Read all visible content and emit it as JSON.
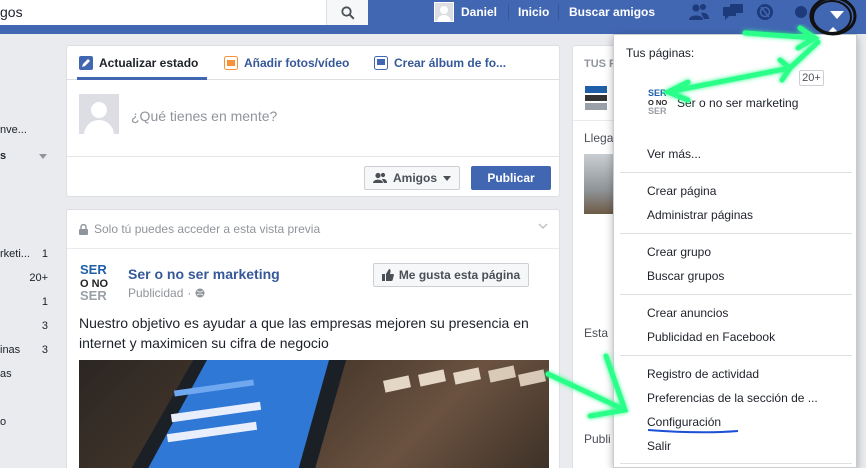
{
  "topbar": {
    "search_value": "gos",
    "user_name": "Daniel",
    "nav_home": "Inicio",
    "nav_find_friends": "Buscar amigos"
  },
  "left_sidebar": {
    "items": [
      {
        "label": "nve..."
      },
      {
        "label": "s"
      },
      {
        "label": "rketi...",
        "count": "1"
      },
      {
        "label": "",
        "count": "20+"
      },
      {
        "label": "",
        "count": "1"
      },
      {
        "label": "",
        "count": "3"
      },
      {
        "label": "inas",
        "count": "3"
      },
      {
        "label": "as"
      },
      {
        "label": "o"
      }
    ]
  },
  "composer": {
    "tab_status": "Actualizar estado",
    "tab_photos": "Añadir fotos/vídeo",
    "tab_album": "Crear álbum de fo...",
    "placeholder": "¿Qué tienes en mente?",
    "audience": "Amigos",
    "publish": "Publicar"
  },
  "post": {
    "preview_notice": "Solo tú puedes acceder a esta vista previa",
    "page_name": "Ser o no ser marketing",
    "meta": "Publicidad",
    "like_button": "Me gusta esta página",
    "text": "Nuestro objetivo es ayudar a que las empresas mejoren su presencia en internet y maximicen su cifra de negocio",
    "logo_lines": [
      "SER",
      "O NO",
      "SER"
    ]
  },
  "right_column": {
    "heading": "TUS P",
    "label_llega": "Llega",
    "label_esta": "Esta",
    "label_publi": "Publi"
  },
  "dropdown": {
    "heading": "Tus páginas:",
    "badge": "20+",
    "page_name": "Ser o no ser marketing",
    "see_more": "Ver más...",
    "create_page": "Crear página",
    "manage_pages": "Administrar páginas",
    "create_group": "Crear grupo",
    "find_groups": "Buscar grupos",
    "create_ads": "Crear anuncios",
    "fb_ads": "Publicidad en Facebook",
    "activity_log": "Registro de actividad",
    "newsfeed_prefs": "Preferencias de la sección de ...",
    "settings": "Configuración",
    "logout": "Salir"
  },
  "colors": {
    "brand": "#4267b2",
    "link": "#365899",
    "annotation_green": "#2cff8a",
    "annotation_blue": "#1a4fd6"
  },
  "icons": [
    "search-icon",
    "friend-requests-icon",
    "messages-icon",
    "notifications-icon",
    "privacy-icon",
    "dropdown-arrow-icon",
    "pencil-icon",
    "photo-icon",
    "album-icon",
    "friends-icon",
    "lock-icon",
    "globe-icon",
    "like-icon",
    "chevron-down-icon"
  ]
}
